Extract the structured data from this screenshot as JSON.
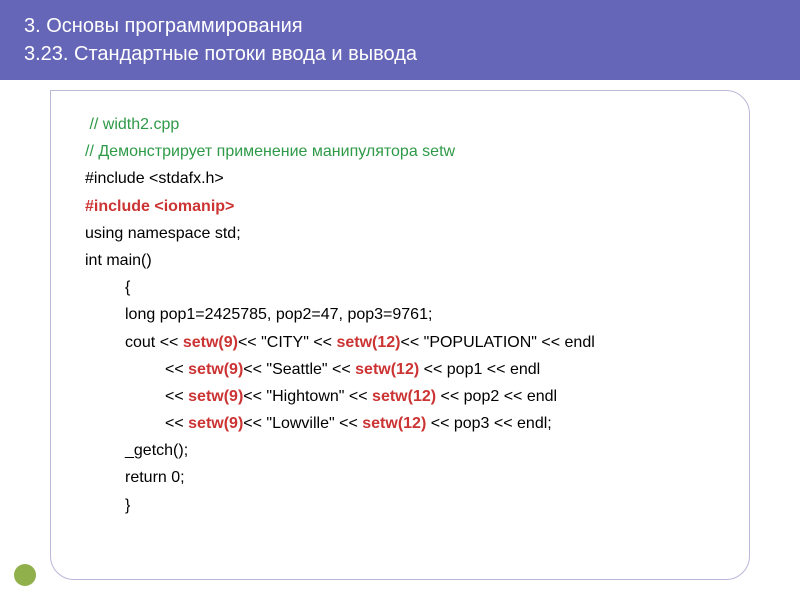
{
  "header": {
    "line1": "3. Основы программирования",
    "line2": "3.23. Стандартные потоки ввода и вывода"
  },
  "code": {
    "c1": " // width2.cpp",
    "c2": "// Демонстрирует применение манипулятора setw",
    "l3": "#include <stdafx.h>",
    "l4a": "#include <iomanip>",
    "l5": "using namespace std;",
    "l6": "int main()",
    "l7": "{",
    "l8": "long pop1=2425785, pop2=47, pop3=9761;",
    "l9a": "cout << ",
    "l9b": "setw(9)",
    "l9c": "<< \"CITY\" << ",
    "l9d": "setw(12)",
    "l9e": "<< \"POPULATION\" << endl",
    "l10a": "<< ",
    "l10b": "setw(9)",
    "l10c": "<< \"Seattle\" << ",
    "l10d": "setw(12)",
    "l10e": " << pop1 << endl",
    "l11a": "<< ",
    "l11b": "setw(9)",
    "l11c": "<< \"Hightown\" << ",
    "l11d": "setw(12)",
    "l11e": " << pop2 << endl",
    "l12a": "<< ",
    "l12b": "setw(9)",
    "l12c": "<< \"Lowville\" << ",
    "l12d": "setw(12)",
    "l12e": " << pop3 << endl;",
    "l13": "_getch();",
    "l14": "return 0;",
    "l15": "}"
  }
}
